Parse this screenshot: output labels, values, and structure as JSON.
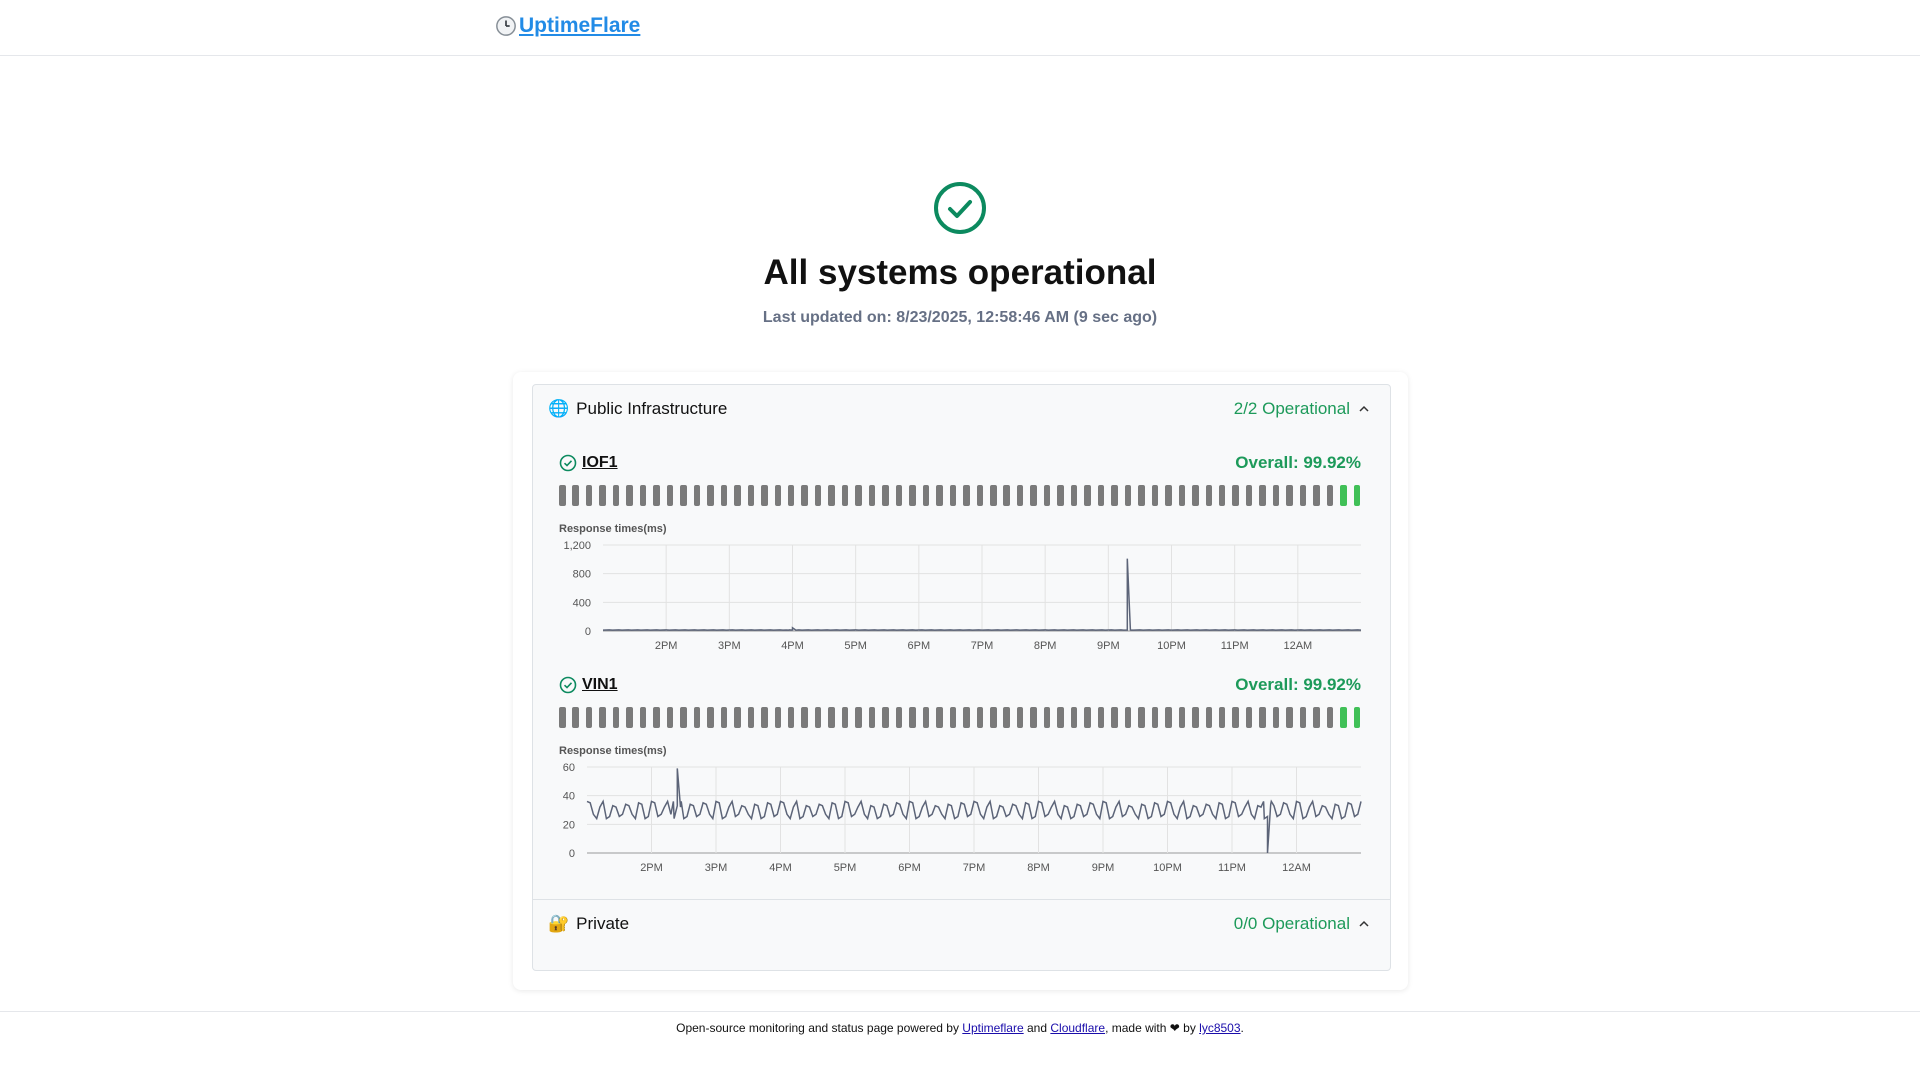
{
  "header": {
    "logo_text": "UptimeFlare",
    "logo_icon": "clock-icon"
  },
  "hero": {
    "title": "All systems operational",
    "last_updated": "Last updated on: 8/23/2025, 12:58:46 AM (9 sec ago)",
    "status_icon": "check-circle-icon",
    "color": "#0c8a5f"
  },
  "groups": [
    {
      "icon": "🌐",
      "name": "Public Infrastructure",
      "status": "2/2 Operational",
      "expanded": true
    },
    {
      "icon": "🔐",
      "name": "Private",
      "status": "0/0 Operational",
      "expanded": false
    }
  ],
  "monitors": [
    {
      "name": "IOF1",
      "overall": "Overall: 99.92%",
      "bars_total": 60,
      "bars_up": 2,
      "chart_title": "Response times(ms)"
    },
    {
      "name": "VIN1",
      "overall": "Overall: 99.92%",
      "bars_total": 60,
      "bars_up": 2,
      "chart_title": "Response times(ms)"
    }
  ],
  "chart_data": [
    {
      "type": "line",
      "title": "Response times(ms)",
      "x_ticks": [
        "2PM",
        "3PM",
        "4PM",
        "5PM",
        "6PM",
        "7PM",
        "8PM",
        "9PM",
        "10PM",
        "11PM",
        "12AM"
      ],
      "y_ticks": [
        "1,200",
        "800",
        "400",
        "0"
      ],
      "ylim": [
        0,
        1200
      ],
      "xrange_hours": [
        13.0,
        25.0
      ],
      "series": [
        {
          "baseline_ms": 12,
          "spikes": [
            [
              16.0,
              45
            ],
            [
              21.3,
              1010
            ]
          ]
        }
      ],
      "grid": true
    },
    {
      "type": "line",
      "title": "Response times(ms)",
      "x_ticks": [
        "2PM",
        "3PM",
        "4PM",
        "5PM",
        "6PM",
        "7PM",
        "8PM",
        "9PM",
        "10PM",
        "11PM",
        "12AM"
      ],
      "y_ticks": [
        "60",
        "40",
        "20",
        "0"
      ],
      "ylim": [
        0,
        60
      ],
      "xrange_hours": [
        13.0,
        25.0
      ],
      "series": [
        {
          "low_ms": 24,
          "high_ms": 36,
          "spikes": [
            [
              14.4,
              59
            ],
            [
              23.55,
              0
            ]
          ]
        }
      ],
      "grid": true
    }
  ],
  "footer": {
    "prefix": "Open-source monitoring and status page powered by ",
    "link1": "Uptimeflare",
    "and": " and ",
    "link2": "Cloudflare",
    "mid": ", made with ❤ by ",
    "link3": "lyc8503",
    "suffix": "."
  }
}
